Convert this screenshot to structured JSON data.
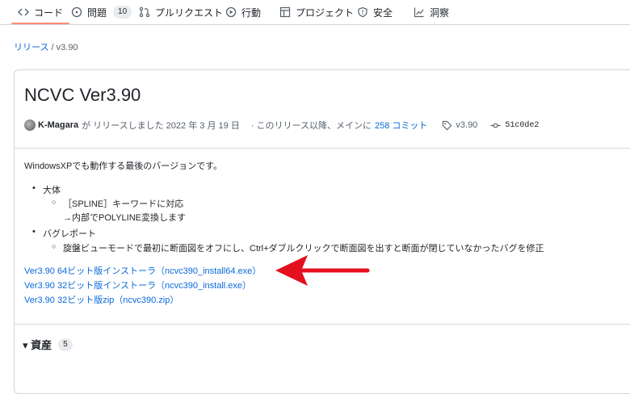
{
  "nav": {
    "tabs": [
      {
        "label": "コード",
        "icon": "code-icon"
      },
      {
        "label": "問題",
        "icon": "issue-icon",
        "count": "10"
      },
      {
        "label": "プルリクエスト",
        "icon": "pull-request-icon"
      },
      {
        "label": "行動",
        "icon": "play-icon"
      },
      {
        "label": "プロジェクト",
        "icon": "table-icon"
      },
      {
        "label": "安全",
        "icon": "shield-icon"
      },
      {
        "label": "洞察",
        "icon": "graph-icon"
      }
    ],
    "active_color": "#fd8c73"
  },
  "breadcrumb": {
    "link": "リリース",
    "sep": "/",
    "current": "v3.90"
  },
  "release": {
    "title": "NCVC Ver3.90",
    "author": "K-Magara",
    "released_text": "が リリースしました 2022 年 3 月 19 日",
    "commits_prefix": "· このリリース以降、メインに",
    "commits_link": "258 コミット",
    "tag": "v3.90",
    "commit_hash": "51c0de2",
    "description": "WindowsXPでも動作する最後のバージョンです。",
    "items": [
      {
        "label": "大体",
        "sub": [
          "［SPLINE］キーワードに対応",
          "→内部でPOLYLINE変換します"
        ]
      },
      {
        "label": "バグレポート",
        "sub": [
          "旋盤ビューモードで最初に断面図をオフにし、Ctrl+ダブルクリックで断面図を出すと断面が閉じていなかったバグを修正"
        ]
      }
    ],
    "downloads": [
      "Ver3.90 64ビット版インストーラ（ncvc390_install64.exe）",
      "Ver3.90 32ビット版インストーラ（ncvc390_install.exe）",
      "Ver3.90 32ビット版zip（ncvc390.zip）"
    ],
    "assets_label": "▾ 資産",
    "assets_count": "5"
  },
  "colors": {
    "link": "#0969da",
    "arrow": "#e3101e"
  }
}
